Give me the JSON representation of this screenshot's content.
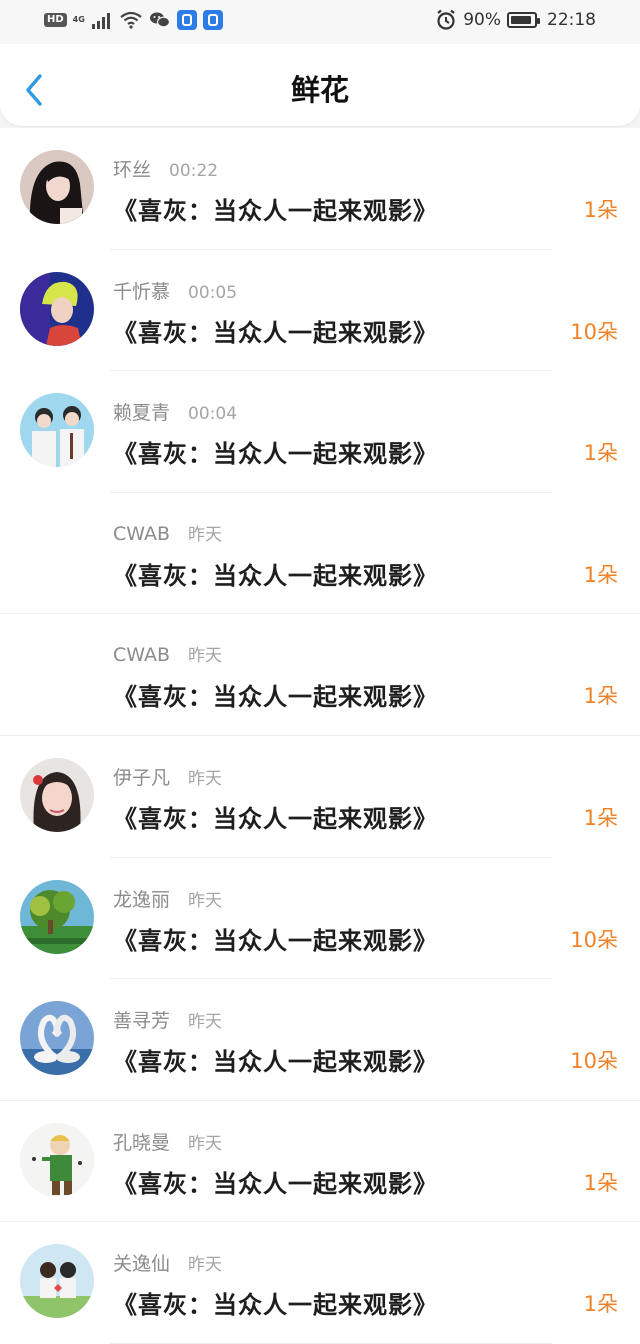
{
  "status_bar": {
    "hd": "HD",
    "net_top": "4G",
    "net_bottom": "",
    "battery": "90%",
    "time": "22:18",
    "icons": [
      "hd-icon",
      "signal-icon",
      "wifi-icon",
      "wechat-icon",
      "app-icon",
      "app-icon",
      "alarm-icon",
      "battery-icon"
    ]
  },
  "header": {
    "title": "鲜花",
    "back_icon": "chevron-left-icon"
  },
  "colors": {
    "accent": "#2f9ae0",
    "count": "#f0822a"
  },
  "items": [
    {
      "name": "环丝",
      "time": "00:22",
      "content": "《喜灰：当众人一起来观影》",
      "count": "1朵",
      "avatar": "photo"
    },
    {
      "name": "千忻慕",
      "time": "00:05",
      "content": "《喜灰：当众人一起来观影》",
      "count": "10朵",
      "avatar": "photo"
    },
    {
      "name": "赖夏青",
      "time": "00:04",
      "content": "《喜灰：当众人一起来观影》",
      "count": "1朵",
      "avatar": "photo"
    },
    {
      "name": "CWAB",
      "time": "昨天",
      "content": "《喜灰：当众人一起来观影》",
      "count": "1朵",
      "avatar": "none"
    },
    {
      "name": "CWAB",
      "time": "昨天",
      "content": "《喜灰：当众人一起来观影》",
      "count": "1朵",
      "avatar": "none"
    },
    {
      "name": "伊子凡",
      "time": "昨天",
      "content": "《喜灰：当众人一起来观影》",
      "count": "1朵",
      "avatar": "photo"
    },
    {
      "name": "龙逸丽",
      "time": "昨天",
      "content": "《喜灰：当众人一起来观影》",
      "count": "10朵",
      "avatar": "photo"
    },
    {
      "name": "善寻芳",
      "time": "昨天",
      "content": "《喜灰：当众人一起来观影》",
      "count": "10朵",
      "avatar": "photo"
    },
    {
      "name": "孔晓曼",
      "time": "昨天",
      "content": "《喜灰：当众人一起来观影》",
      "count": "1朵",
      "avatar": "photo"
    },
    {
      "name": "关逸仙",
      "time": "昨天",
      "content": "《喜灰：当众人一起来观影》",
      "count": "1朵",
      "avatar": "photo"
    }
  ]
}
